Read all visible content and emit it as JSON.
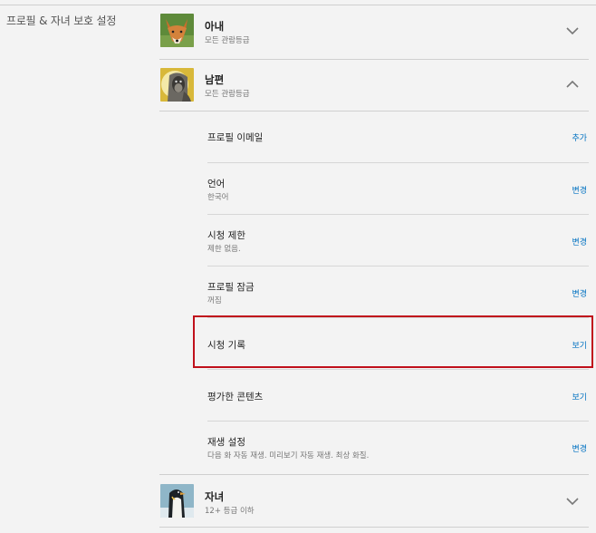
{
  "section_title": "프로필 & 자녀 보호 설정",
  "profiles": [
    {
      "name": "아내",
      "rating": "모든 관람등급",
      "avatar": "fox-avatar",
      "expanded": false
    },
    {
      "name": "남편",
      "rating": "모든 관람등급",
      "avatar": "monkey-avatar",
      "expanded": true
    },
    {
      "name": "자녀",
      "rating": "12+ 등급 이하",
      "avatar": "penguin-avatar",
      "expanded": false
    }
  ],
  "settings": [
    {
      "label": "프로필 이메일",
      "sub": "",
      "action": "추가"
    },
    {
      "label": "언어",
      "sub": "한국어",
      "action": "변경"
    },
    {
      "label": "시청 제한",
      "sub": "제한 없음.",
      "action": "변경"
    },
    {
      "label": "프로필 잠금",
      "sub": "꺼짐",
      "action": "변경"
    },
    {
      "label": "시청 기록",
      "sub": "",
      "action": "보기",
      "highlighted": true
    },
    {
      "label": "평가한 콘텐츠",
      "sub": "",
      "action": "보기"
    },
    {
      "label": "재생 설정",
      "sub": "다음 화 자동 재생. 미리보기 자동 재생. 최상 화질.",
      "action": "변경"
    }
  ],
  "colors": {
    "link": "#0071c1",
    "highlight": "#c0101b",
    "background": "#f3f3f3"
  }
}
